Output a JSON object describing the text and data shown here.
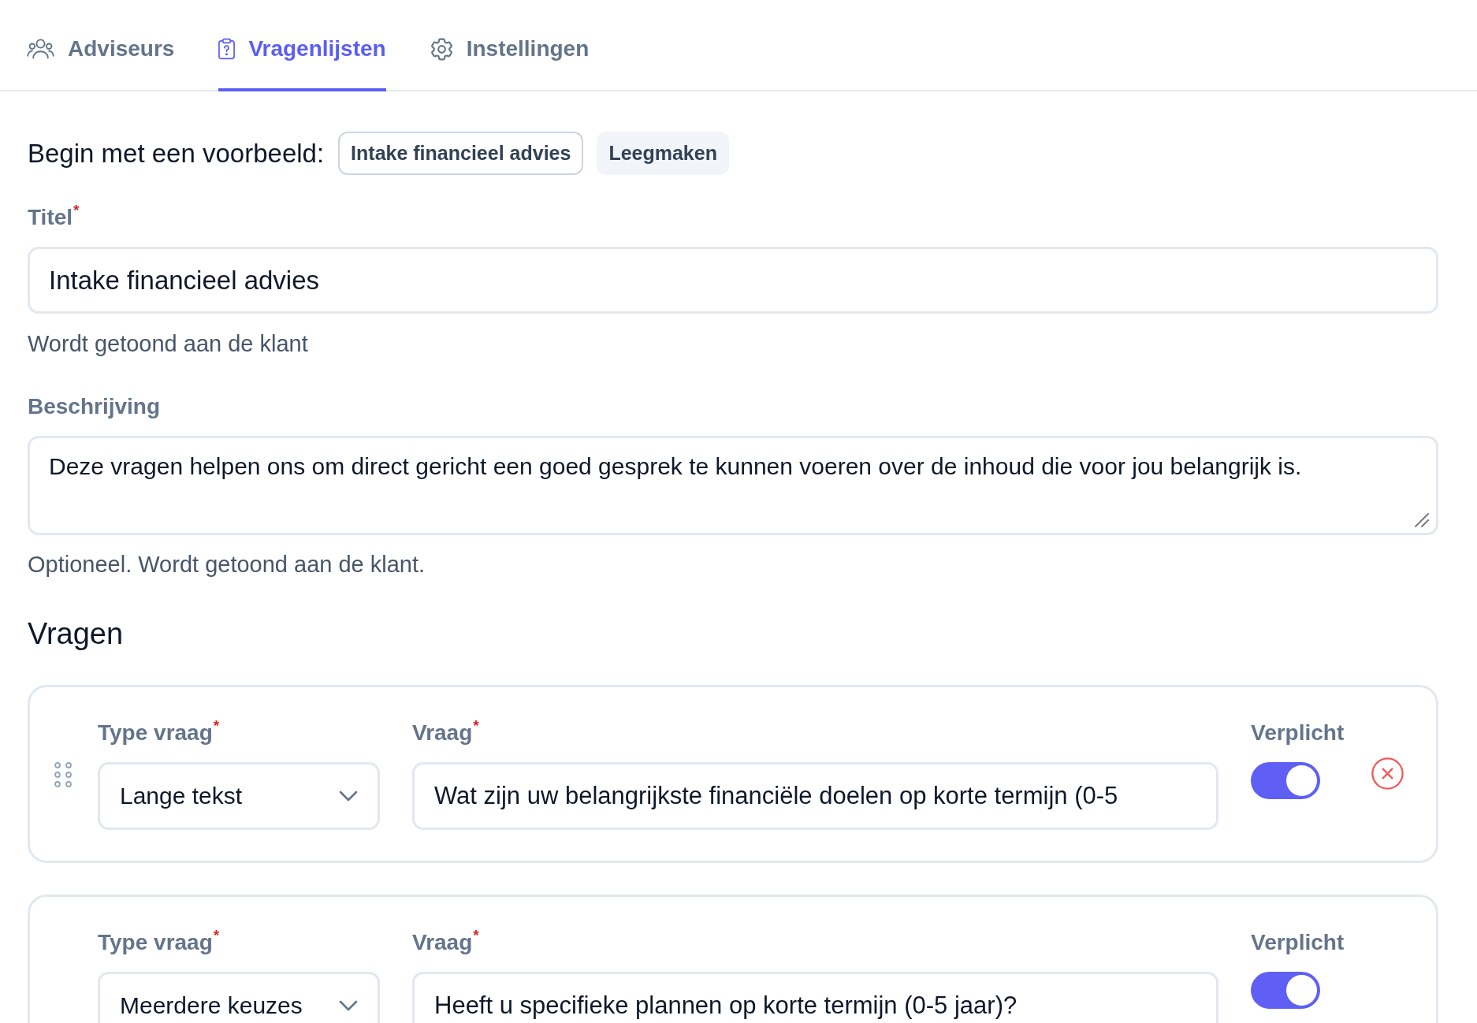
{
  "tabs": [
    {
      "label": "Adviseurs",
      "selected": false
    },
    {
      "label": "Vragenlijsten",
      "selected": true
    },
    {
      "label": "Instellingen",
      "selected": false
    }
  ],
  "template_bar": {
    "label": "Begin met een voorbeeld:",
    "buttons": [
      {
        "label": "Intake financieel advies",
        "kind": "outline"
      },
      {
        "label": "Leegmaken",
        "kind": "subtle"
      }
    ]
  },
  "title_field": {
    "label": "Titel$^{*}$",
    "value": "Intake financieel advies",
    "help": "Wordt getoond aan de klant"
  },
  "description_field": {
    "label": "Beschrijving",
    "value": "Deze vragen helpen ons om direct gericht een goed gesprek te kunnen voeren over de inhoud die voor jou belangrijk is.",
    "help": "Optioneel. Wordt getoond aan de klant."
  },
  "questions_section": {
    "heading": "Vragen",
    "questions": [
      {
        "type_label": "Type vraag$^{*}$",
        "type_value": "Lange tekst",
        "question_label": "Vraag$^{*}$",
        "question_value": "Wat zijn uw belangrijkste financiële doelen op korte termijn (0-5",
        "required_label": "Verplicht",
        "required": true,
        "drag_handle": true,
        "remove_button": true
      },
      {
        "type_label": "Type vraag$^{*}$",
        "type_value": "Meerdere keuzes",
        "question_label": "Vraag$^{*}$",
        "question_value": "Heeft u specifieke plannen op korte termijn (0-5 jaar)?",
        "required_label": "Verplicht",
        "required": true,
        "drag_handle": false,
        "remove_button": false
      }
    ]
  }
}
